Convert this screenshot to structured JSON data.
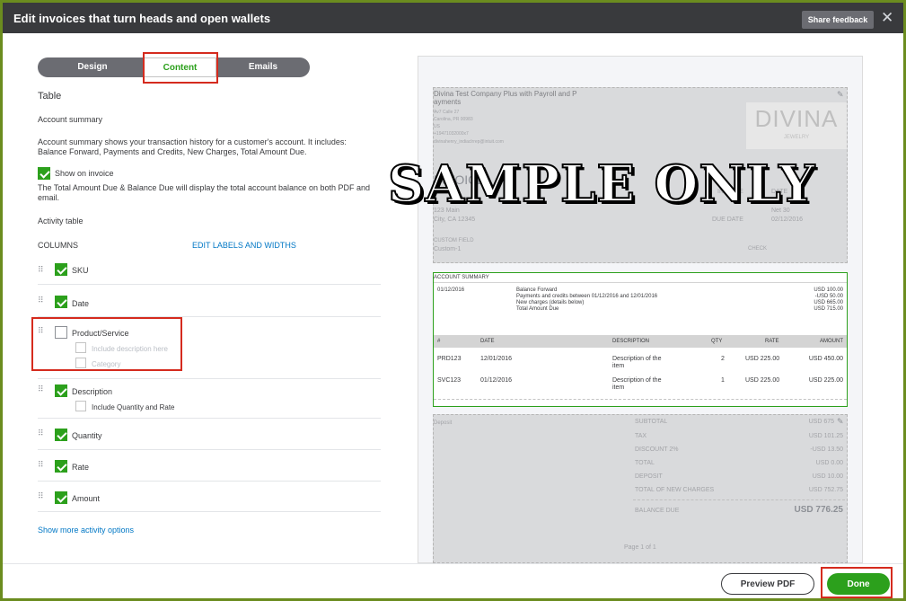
{
  "header": {
    "title": "Edit invoices that turn heads and open wallets",
    "share_feedback": "Share feedback",
    "close": "✕"
  },
  "tabs": [
    {
      "label": "Design"
    },
    {
      "label": "Content",
      "selected": true
    },
    {
      "label": "Emails"
    }
  ],
  "left": {
    "section_title": "Table",
    "account_summary_heading": "Account summary",
    "account_summary_desc_1": "Account summary shows your transaction history for a customer's account. It includes:",
    "account_summary_desc_2": "Balance Forward, Payments and Credits, New Charges, Total Amount Due.",
    "show_on_invoice": "Show on invoice",
    "total_note_1": "The Total Amount Due & Balance Due will display the total account balance on both PDF and",
    "total_note_2": "email.",
    "activity_table": "Activity table",
    "columns_label": "COLUMNS",
    "edit_labels": "EDIT LABELS AND WIDTHS",
    "columns": [
      {
        "label": "SKU",
        "checked": true
      },
      {
        "label": "Date",
        "checked": true
      },
      {
        "label": "Product/Service",
        "checked": false,
        "options": [
          "Include description here",
          "Category"
        ]
      },
      {
        "label": "Description",
        "checked": true,
        "options": [
          "Include Quantity and Rate"
        ]
      },
      {
        "label": "Quantity",
        "checked": true
      },
      {
        "label": "Rate",
        "checked": true
      },
      {
        "label": "Amount",
        "checked": true
      }
    ],
    "show_more": "Show more activity options"
  },
  "preview": {
    "company_name_1": "Divina Test Company Plus with Payroll and P",
    "company_name_2": "ayments",
    "address_1": "Av7 Calle 27",
    "address_2": "Carolina, PR 00983",
    "address_3": "US",
    "phone": "+19471032000x7",
    "email": "divinahenry_indiaclrrep@intuit.com",
    "logo_text": "DIVINA",
    "logo_sub": "JEWELRY",
    "invoice_title": "INVOICE",
    "invoice_no_label": "INVOICE",
    "date_label": "DATE",
    "due_date_label": "DUE DATE",
    "due_date": "02/12/2016",
    "terms": "Net 30",
    "bill_to_street": "123 Main",
    "bill_to_city": "City, CA 12345",
    "custom_field_label": "CUSTOM FIELD",
    "custom_field_value": "Custom-1",
    "check_label": "CHECK",
    "summary": {
      "heading": "ACCOUNT SUMMARY",
      "date": "01/12/2016",
      "lines": [
        {
          "label": "Balance Forward",
          "amount": "USD 100.00"
        },
        {
          "label": "Payments and credits between 01/12/2016 and 12/01/2016",
          "amount": "-USD 50.00"
        },
        {
          "label": "New charges (details below)",
          "amount": "USD 665.00"
        },
        {
          "label": "Total Amount Due",
          "amount": "USD 715.00"
        }
      ]
    },
    "table_headers": [
      "#",
      "DATE",
      "DESCRIPTION",
      "QTY",
      "RATE",
      "AMOUNT"
    ],
    "rows": [
      {
        "sku": "PRD123",
        "date": "12/01/2016",
        "desc_1": "Description of the",
        "desc_2": "item",
        "qty": "2",
        "rate": "USD 225.00",
        "amount": "USD 450.00"
      },
      {
        "sku": "SVC123",
        "date": "01/12/2016",
        "desc_1": "Description of the",
        "desc_2": "item",
        "qty": "1",
        "rate": "USD 225.00",
        "amount": "USD 225.00"
      }
    ],
    "deposit_label": "Deposit",
    "totals": [
      {
        "label": "SUBTOTAL",
        "amount": "USD 675"
      },
      {
        "label": "TAX",
        "amount": "USD 101.25"
      },
      {
        "label": "DISCOUNT 2%",
        "amount": "-USD 13.50"
      },
      {
        "label": "TOTAL",
        "amount": "USD 0.00"
      },
      {
        "label": "DEPOSIT",
        "amount": "USD 10.00"
      },
      {
        "label": "TOTAL OF NEW CHARGES",
        "amount": "USD 752.75"
      }
    ],
    "balance_due_label": "BALANCE DUE",
    "balance_due": "USD 776.25",
    "page": "Page 1 of 1"
  },
  "watermark": "SAMPLE ONLY",
  "footer": {
    "preview_pdf": "Preview PDF",
    "done": "Done"
  },
  "colors": {
    "accent": "#2ca01c",
    "header_bg": "#393a3d",
    "highlight": "#d52b1e",
    "link": "#0077c5"
  }
}
